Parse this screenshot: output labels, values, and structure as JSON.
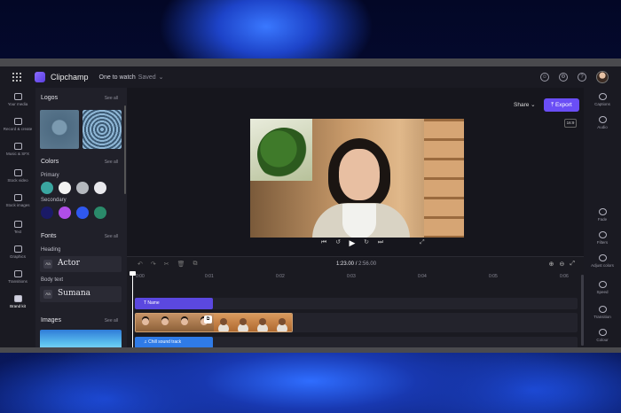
{
  "app": {
    "name": "Clipchamp",
    "project_title": "One to watch",
    "save_status": "Saved"
  },
  "topbar_icons": [
    "grid-icon",
    "smile-icon",
    "gear-icon",
    "help-icon",
    "avatar"
  ],
  "left_rail": [
    {
      "label": "Your media",
      "icon": "folder-icon"
    },
    {
      "label": "Record & create",
      "icon": "camera-icon"
    },
    {
      "label": "Music & SFX",
      "icon": "music-icon"
    },
    {
      "label": "Stock video",
      "icon": "film-icon"
    },
    {
      "label": "Stock images",
      "icon": "image-icon"
    },
    {
      "label": "Text",
      "icon": "text-icon"
    },
    {
      "label": "Graphics",
      "icon": "shapes-icon"
    },
    {
      "label": "Transitions",
      "icon": "transition-icon"
    },
    {
      "label": "Brand kit",
      "icon": "brand-kit-icon",
      "active": true
    }
  ],
  "brand_panel": {
    "logos_title": "Logos",
    "colors_title": "Colors",
    "primary_label": "Primary",
    "secondary_label": "Secondary",
    "fonts_title": "Fonts",
    "heading_label": "Heading",
    "heading_font": "Actor",
    "body_label": "Body text",
    "body_font": "Sumana",
    "images_title": "Images",
    "see_all": "See all",
    "font_badge": "Aa",
    "primary_colors": [
      "#3aa6a0",
      "#f2f2f2",
      "#b4b8be",
      "#e8e8ec"
    ],
    "secondary_colors": [
      "#1a1a66",
      "#b04ee8",
      "#2f58f0",
      "#2a8a6a"
    ]
  },
  "preview": {
    "share_label": "Share",
    "export_label": "Export",
    "aspect_ratio": "16:9"
  },
  "right_rail": [
    {
      "label": "Captions",
      "icon": "captions-icon"
    },
    {
      "label": "Audio",
      "icon": "audio-icon"
    },
    {
      "label": "Fade",
      "icon": "fade-icon"
    },
    {
      "label": "Filters",
      "icon": "filters-icon"
    },
    {
      "label": "Adjust colors",
      "icon": "adjust-colors-icon"
    },
    {
      "label": "Speed",
      "icon": "speed-icon"
    },
    {
      "label": "Transition",
      "icon": "transition-icon"
    },
    {
      "label": "Colour",
      "icon": "colour-icon"
    }
  ],
  "timeline": {
    "current_time": "1:23.00",
    "total_time": "2:56.00",
    "ruler": [
      "0:00",
      "0:01",
      "0:02",
      "0:03",
      "0:04",
      "0:05",
      "0:06"
    ],
    "text_clip": "Name",
    "audio_clip": "Chill sound track"
  },
  "colors": {
    "accent": "#6a4ef5",
    "text_clip": "#5b48e0",
    "audio_clip": "#2f7be8"
  }
}
